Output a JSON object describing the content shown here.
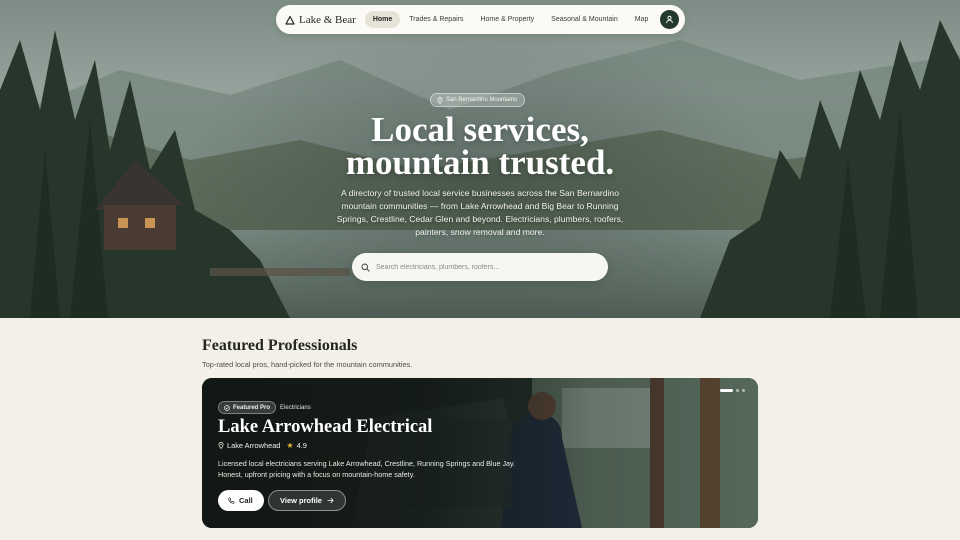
{
  "nav": {
    "brand": "Lake & Bear",
    "links": [
      "Home",
      "Trades & Repairs",
      "Home & Property",
      "Seasonal & Mountain",
      "Map"
    ],
    "active": "Home",
    "account_icon": "user-icon"
  },
  "hero": {
    "region": "San Bernardino Mountains",
    "title_line1": "Local services,",
    "title_line2": "mountain trusted.",
    "description": "A directory of trusted local service businesses across the San Bernardino mountain communities — from Lake Arrowhead and Big Bear to Running Springs, Crestline, Cedar Glen and beyond. Electricians, plumbers, roofers, painters, snow removal and more.",
    "search_placeholder": "Search electricians, plumbers, roofers..."
  },
  "featured": {
    "title": "Featured Professionals",
    "subtitle": "Top-rated local pros, hand-picked for the mountain communities.",
    "card": {
      "badge": "Featured Pro",
      "category": "Electricians",
      "name": "Lake Arrowhead Electrical",
      "location": "Lake Arrowhead",
      "rating": "4.9",
      "description": "Licensed local electricians serving Lake Arrowhead, Crestline, Running Springs and Blue Jay. Honest, upfront pricing with a focus on mountain-home safety.",
      "call_label": "Call",
      "view_label": "View profile",
      "slides": 3,
      "active_slide": 1
    }
  },
  "colors": {
    "background": "#f3f0e8",
    "accent_dark_green": "#24392d",
    "star": "#e2b53c"
  }
}
